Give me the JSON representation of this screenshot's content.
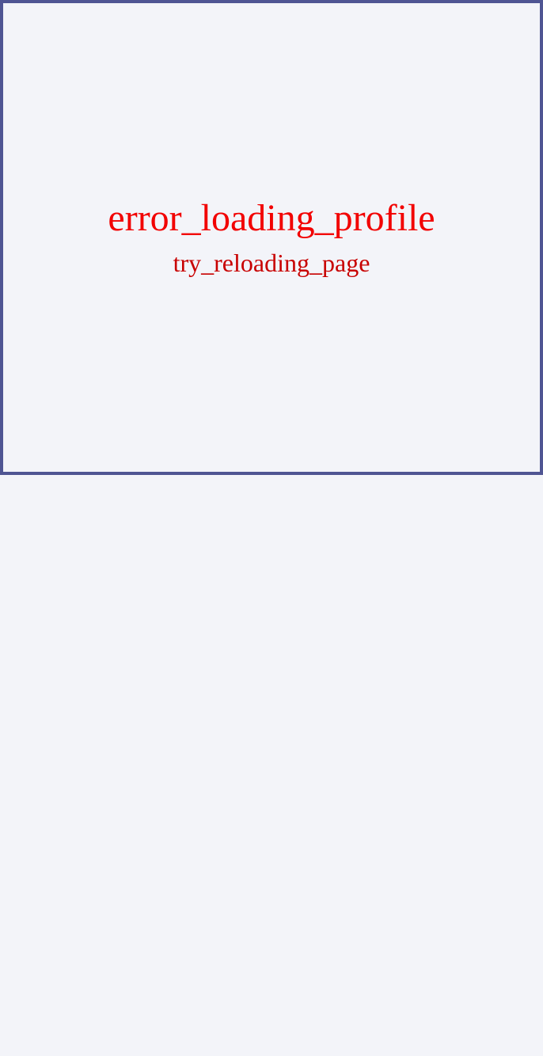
{
  "error": {
    "title": "error_loading_profile",
    "subtitle": "try_reloading_page"
  },
  "colors": {
    "background": "#f3f4f9",
    "border": "#4f5593",
    "title": "#f20000",
    "subtitle": "#c80000"
  }
}
